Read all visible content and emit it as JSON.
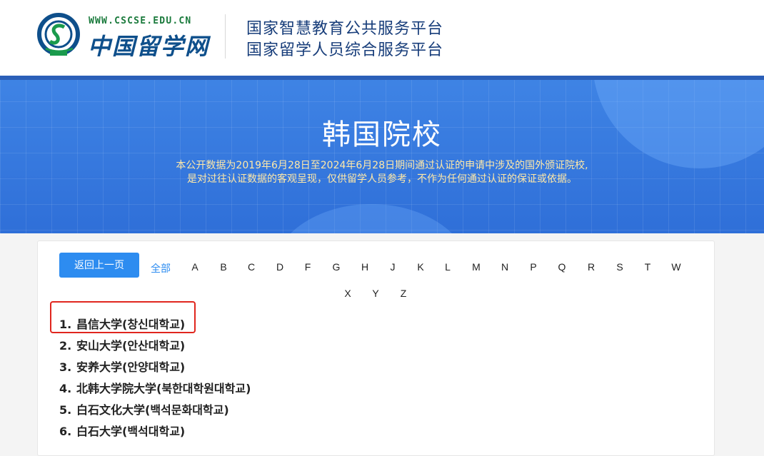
{
  "header": {
    "logo_url": "WWW.CSCSE.EDU.CN",
    "logo_cn": "中国留学网",
    "platform_line1": "国家智慧教育公共服务平台",
    "platform_line2": "国家留学人员综合服务平台"
  },
  "banner": {
    "title": "韩国院校",
    "note_line1": "本公开数据为2019年6月28日至2024年6月28日期间通过认证的申请中涉及的国外颁证院校,",
    "note_line2": "是对过往认证数据的客观呈现，仅供留学人员参考，不作为任何通过认证的保证或依据。"
  },
  "filter": {
    "back_label": "返回上一页",
    "all_label": "全部",
    "letters": [
      "A",
      "B",
      "C",
      "D",
      "F",
      "G",
      "H",
      "J",
      "K",
      "L",
      "M",
      "N",
      "P",
      "Q",
      "R",
      "S",
      "T",
      "W",
      "X",
      "Y",
      "Z"
    ]
  },
  "schools": [
    {
      "num": "1.",
      "name": "昌信大学(창신대학교)"
    },
    {
      "num": "2.",
      "name": "安山大学(안산대학교)"
    },
    {
      "num": "3.",
      "name": "安养大学(안양대학교)"
    },
    {
      "num": "4.",
      "name": "北韩大学院大学(북한대학원대학교)"
    },
    {
      "num": "5.",
      "name": "白石文化大学(백석문화대학교)"
    },
    {
      "num": "6.",
      "name": "白石大学(백석대학교)"
    }
  ],
  "colors": {
    "accent": "#2d8cf0",
    "banner": "#3f84e5",
    "highlight": "#e0261e",
    "note": "#ffe9a8"
  }
}
